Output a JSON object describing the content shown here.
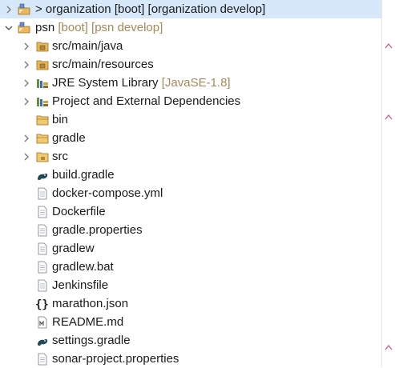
{
  "tree": {
    "root1": {
      "label_main": "> organization",
      "label_deco": " [boot] [organization develop]"
    },
    "root2": {
      "label_main": "psn",
      "label_deco": " [boot] [psn develop]"
    },
    "children": [
      {
        "label": "src/main/java",
        "icon": "source-folder-icon"
      },
      {
        "label": "src/main/resources",
        "icon": "source-folder-icon"
      },
      {
        "label": "JRE System Library",
        "deco": " [JavaSE-1.8]",
        "icon": "library-icon"
      },
      {
        "label": "Project and External Dependencies",
        "icon": "library-icon"
      },
      {
        "label": "bin",
        "icon": "folder-icon"
      },
      {
        "label": "gradle",
        "icon": "folder-icon"
      },
      {
        "label": "src",
        "icon": "folder-icon"
      },
      {
        "label": "build.gradle",
        "icon": "gradle-file-icon"
      },
      {
        "label": "docker-compose.yml",
        "icon": "text-file-icon"
      },
      {
        "label": "Dockerfile",
        "icon": "text-file-icon"
      },
      {
        "label": "gradle.properties",
        "icon": "text-file-icon"
      },
      {
        "label": "gradlew",
        "icon": "text-file-icon"
      },
      {
        "label": "gradlew.bat",
        "icon": "text-file-icon"
      },
      {
        "label": "Jenkinsfile",
        "icon": "text-file-icon"
      },
      {
        "label": "marathon.json",
        "icon": "json-file-icon"
      },
      {
        "label": "README.md",
        "icon": "markdown-file-icon"
      },
      {
        "label": "settings.gradle",
        "icon": "gradle-file-icon"
      },
      {
        "label": "sonar-project.properties",
        "icon": "text-file-icon"
      }
    ]
  },
  "colors": {
    "selection": "#d7e8fb",
    "decoration_text": "#a4885a",
    "scroll_arrow": "#c5587a"
  }
}
